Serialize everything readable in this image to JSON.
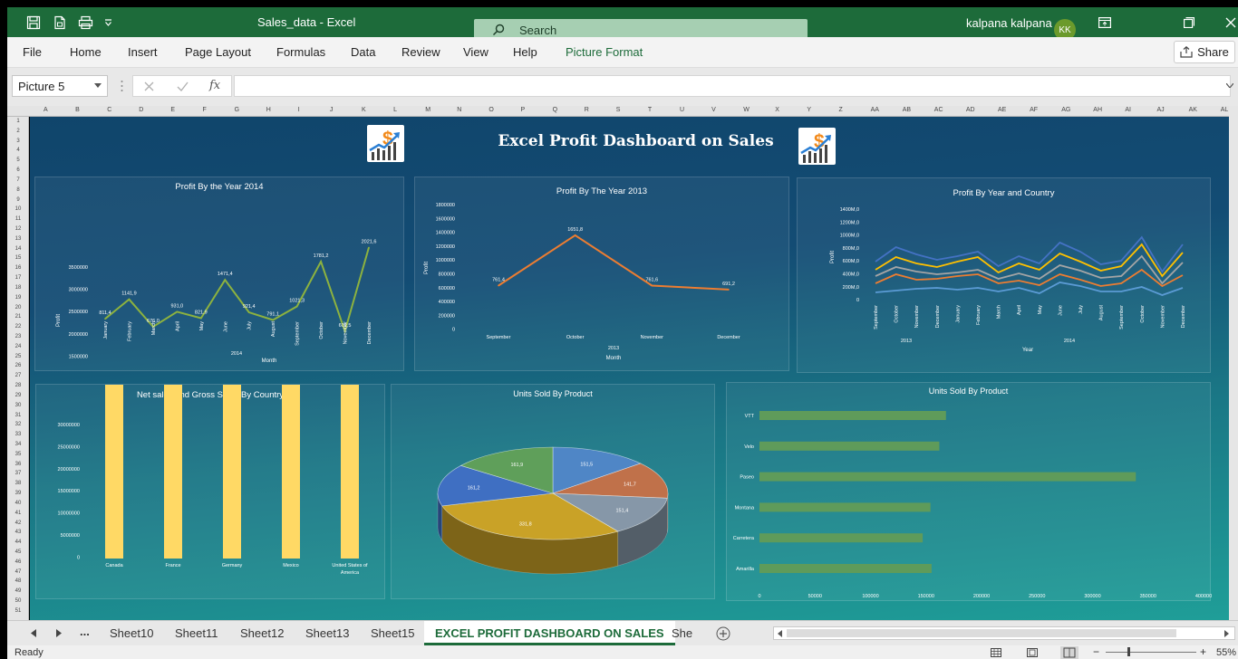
{
  "titlebar": {
    "doc_title": "Sales_data  -  Excel",
    "search_label": "Search",
    "user_name": "kalpana kalpana",
    "avatar_initials": "KK",
    "bg_color": "#1d6b3a"
  },
  "ribbon": {
    "tabs": [
      "File",
      "Home",
      "Insert",
      "Page Layout",
      "Formulas",
      "Data",
      "Review",
      "View",
      "Help",
      "Picture Format"
    ],
    "share_label": "Share",
    "active_color": "#1d6b3a"
  },
  "formula_bar": {
    "name_box": "Picture 5",
    "fx": "fx",
    "value": ""
  },
  "grid": {
    "columns": [
      "A",
      "B",
      "C",
      "D",
      "E",
      "F",
      "G",
      "H",
      "I",
      "J",
      "K",
      "L",
      "M",
      "N",
      "O",
      "P",
      "Q",
      "R",
      "S",
      "T",
      "U",
      "V",
      "W",
      "X",
      "Y",
      "Z",
      "AA",
      "AB",
      "AC",
      "AD",
      "AE",
      "AF",
      "AG",
      "AH",
      "AI",
      "AJ",
      "AK",
      "AL"
    ],
    "rows": [
      "1",
      "2",
      "3",
      "4",
      "5",
      "6",
      "7",
      "8",
      "9",
      "10",
      "11",
      "12",
      "13",
      "14",
      "15",
      "16",
      "17",
      "18",
      "19",
      "20",
      "21",
      "22",
      "23",
      "24",
      "25",
      "26",
      "27",
      "28",
      "29",
      "30",
      "31",
      "32",
      "33",
      "34",
      "35",
      "36",
      "37",
      "38",
      "39",
      "40",
      "41",
      "42",
      "43",
      "44",
      "45",
      "46",
      "47",
      "48",
      "49",
      "50",
      "51"
    ]
  },
  "dashboard": {
    "title": "Excel Profit Dashboard on Sales",
    "logo_icon": "dollar-growth-chart-icon",
    "charts": {
      "c2014": {
        "title": "Profit By the Year 2014",
        "year": "2014",
        "xlabel": "Month",
        "ylabel": "Profit",
        "color": "#8db23f",
        "months": [
          "January",
          "February",
          "March",
          "April",
          "May",
          "June",
          "July",
          "August",
          "September",
          "October",
          "November",
          "December"
        ],
        "values": [
          811.4,
          1141.9,
          676.0,
          931.0,
          821.9,
          1471.4,
          921.4,
          791.1,
          1021.3,
          1781.2,
          601.5,
          2021.6
        ],
        "labels": [
          "811,4",
          "1141,9",
          "676,0",
          "931,0",
          "821,9",
          "1471,4",
          "921,4",
          "791,1",
          "1021,3",
          "1781,2",
          "601,5",
          "2021,6"
        ],
        "ticks": [
          "3500000",
          "3000000",
          "2500000",
          "2000000",
          "1500000",
          "1000000",
          "500000",
          "0"
        ]
      },
      "c2013": {
        "title": "Profit By The Year 2013",
        "year": "2013",
        "xlabel": "Month",
        "ylabel": "Profit",
        "color": "#ed7d31",
        "months": [
          "September",
          "October",
          "November",
          "December"
        ],
        "values": [
          761.4,
          1651.8,
          761.6,
          691.2
        ],
        "labels": [
          "761,4",
          "1651,8",
          "761,6",
          "691,2"
        ],
        "ticks": [
          "1800000",
          "1600000",
          "1400000",
          "1200000",
          "1000000",
          "800000",
          "600000",
          "400000",
          "200000",
          "0"
        ]
      },
      "cCountry": {
        "title": "Profit By Year and Country",
        "xlabel": "Year",
        "ylabel": "Profit",
        "months": [
          "September",
          "October",
          "November",
          "December",
          "January",
          "February",
          "March",
          "April",
          "May",
          "June",
          "July",
          "August",
          "September",
          "October",
          "November",
          "December"
        ],
        "year_labels": [
          "2013",
          "2014"
        ],
        "ticks": [
          "1400M,0",
          "1200M,0",
          "1000M,0",
          "800M,0",
          "600M,0",
          "400M,0",
          "200M,0",
          "0"
        ],
        "series": [
          {
            "color": "#5b9bd5",
            "values": [
              80,
              100,
              120,
              130,
              110,
              130,
              90,
              130,
              70,
              190,
              150,
              90,
              90,
              140,
              50,
              130
            ]
          },
          {
            "color": "#ed7d31",
            "values": [
              180,
              280,
              220,
              230,
              260,
              280,
              180,
              210,
              160,
              280,
              220,
              150,
              180,
              330,
              150,
              270
            ]
          },
          {
            "color": "#a5a5a5",
            "values": [
              260,
              360,
              310,
              280,
              300,
              330,
              230,
              290,
              230,
              380,
              320,
              240,
              260,
              480,
              180,
              410
            ]
          },
          {
            "color": "#ffc000",
            "values": [
              330,
              470,
              400,
              360,
              420,
              470,
              300,
              400,
              330,
              510,
              420,
              320,
              370,
              610,
              260,
              520
            ]
          },
          {
            "color": "#4472c4",
            "values": [
              420,
              580,
              500,
              440,
              480,
              530,
              370,
              480,
              400,
              630,
              530,
              390,
              430,
              690,
              310,
              610
            ]
          }
        ]
      },
      "cNetGross": {
        "title": "Net sales and Gross Sales By Country",
        "bar_color": "#ffd965",
        "line_color": "#ed7d31",
        "countries": [
          "Canada",
          "France",
          "Germany",
          "Mexico",
          "United States of America"
        ],
        "net": [
          24887.7,
          24354.4,
          23505.3,
          20949.9,
          25029.0
        ],
        "gross": [
          26888.1,
          24354.4,
          23505.3,
          20949.9,
          25029.0
        ],
        "labels": [
          "2488M,8",
          "2435M,4",
          "2350M,5",
          "2094M,9",
          "2503M,0"
        ],
        "ticks": [
          "30000000",
          "25000000",
          "20000000",
          "15000000",
          "10000000",
          "5000000",
          "0"
        ]
      },
      "cPie": {
        "title": "Units Sold By Product",
        "slices": [
          {
            "label": "151,5",
            "value": 151.5,
            "color": "#4f86c6"
          },
          {
            "label": "141,7",
            "value": 141.7,
            "color": "#c0714a"
          },
          {
            "label": "151,4",
            "value": 151.4,
            "color": "#8697a8"
          },
          {
            "label": "331,8",
            "value": 331.8,
            "color": "#c9a227"
          },
          {
            "label": "161,2",
            "value": 161.2,
            "color": "#3f6fc2"
          },
          {
            "label": "161,9",
            "value": 161.9,
            "color": "#5f9f5a"
          }
        ]
      },
      "cBar": {
        "title": "Units Sold By Product",
        "bar_color": "#5f9b5a",
        "products": [
          "VTT",
          "Velo",
          "Paseo",
          "Montana",
          "Carretera",
          "Amarilla"
        ],
        "values": [
          168000,
          162000,
          339000,
          154000,
          147000,
          155000
        ],
        "ticks": [
          "0",
          "50000",
          "100000",
          "150000",
          "200000",
          "250000",
          "300000",
          "350000",
          "400000"
        ]
      }
    }
  },
  "sheet_tabs": {
    "tabs": [
      "Sheet10",
      "Sheet11",
      "Sheet12",
      "Sheet13",
      "Sheet15",
      "EXCEL PROFIT DASHBOARD ON SALES",
      "She"
    ],
    "active": "EXCEL PROFIT DASHBOARD ON SALES",
    "more_label": "..."
  },
  "status": {
    "ready": "Ready",
    "zoom": "55%"
  }
}
